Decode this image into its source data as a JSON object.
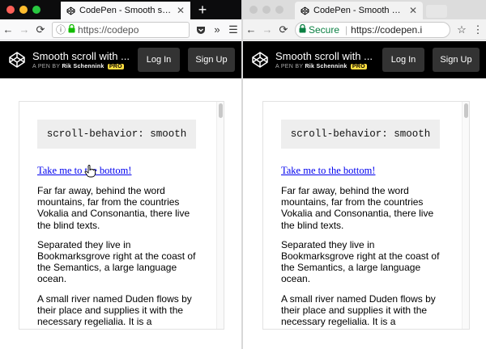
{
  "left_window": {
    "tab": {
      "title": "CodePen - Smooth scroll with h",
      "close": "✕"
    },
    "newtab": "+",
    "toolbar": {
      "back": "←",
      "forward": "→",
      "reload": "⟳",
      "info": "ⓘ",
      "lock": "🔒",
      "url": "https://codepo",
      "more": "»",
      "menu": "☰"
    }
  },
  "right_window": {
    "tab": {
      "title": "CodePen - Smooth scroll with s",
      "close": "✕"
    },
    "toolbar": {
      "back": "←",
      "forward": "→",
      "reload": "⟳",
      "secure_label": "Secure",
      "url": "https://codepen.i",
      "star": "☆",
      "menu": "⋮"
    }
  },
  "header": {
    "title": "Smooth scroll with ...",
    "byline_prefix": "A PEN BY",
    "author": "Rik Schennink",
    "pro_badge": "PRO",
    "login_label": "Log In",
    "signup_label": "Sign Up"
  },
  "content": {
    "code": "scroll-behavior: smooth",
    "link_text": "Take me to the bottom!",
    "paragraphs": [
      "Far far away, behind the word mountains, far from the countries Vokalia and Consonantia, there live the blind texts.",
      "Separated they live in Bookmarksgrove right at the coast of the Semantics, a large language ocean.",
      "A small river named Duden flows by their place and supplies it with the necessary regelialia. It is a paradisematic country, in which"
    ]
  },
  "colors": {
    "traffic_red": "#ff5f57",
    "traffic_yellow": "#febc2e",
    "traffic_green": "#28c840",
    "traffic_inactive": "#c8c8c8",
    "secure_green": "#0b8043",
    "link_blue": "#0000ee",
    "header_bg": "#000000",
    "pro_yellow": "#ffdd40"
  }
}
